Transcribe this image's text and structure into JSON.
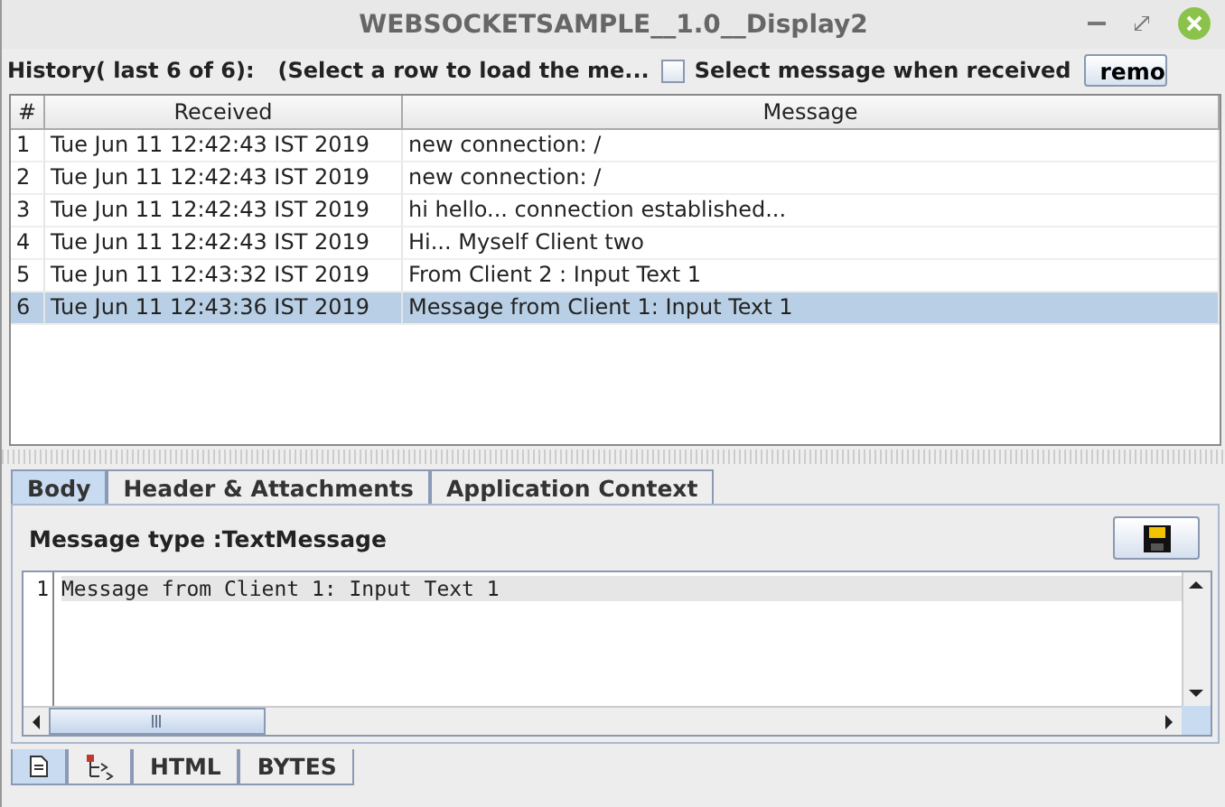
{
  "window": {
    "title": "WEBSOCKETSAMPLE__1.0__Display2"
  },
  "toolbar": {
    "history_label": "History( last 6 of 6):",
    "hint": "(Select a row to load the me...",
    "auto_select": {
      "label": "Select message when received",
      "checked": false
    },
    "remove_button": "remo"
  },
  "table": {
    "columns": [
      "#",
      "Received",
      "Message"
    ],
    "rows": [
      {
        "cells": [
          "1",
          "Tue Jun 11 12:42:43 IST 2019",
          "new connection: /"
        ],
        "selected": false
      },
      {
        "cells": [
          "2",
          "Tue Jun 11 12:42:43 IST 2019",
          "new connection: /"
        ],
        "selected": false
      },
      {
        "cells": [
          "3",
          "Tue Jun 11 12:42:43 IST 2019",
          "hi hello... connection established..."
        ],
        "selected": false
      },
      {
        "cells": [
          "4",
          "Tue Jun 11 12:42:43 IST 2019",
          "Hi... Myself Client two"
        ],
        "selected": false
      },
      {
        "cells": [
          "5",
          "Tue Jun 11 12:43:32 IST 2019",
          "From Client 2 : Input Text 1"
        ],
        "selected": false
      },
      {
        "cells": [
          "6",
          "Tue Jun 11 12:43:36 IST 2019",
          "Message from Client 1: Input Text 1"
        ],
        "selected": true
      }
    ]
  },
  "tabs": [
    {
      "label": "Body",
      "selected": true
    },
    {
      "label": "Header & Attachments",
      "selected": false
    },
    {
      "label": "Application Context",
      "selected": false
    }
  ],
  "body": {
    "message_type": "Message type :TextMessage",
    "editor_lines": [
      {
        "number": "1",
        "text": "Message from Client 1: Input Text 1"
      }
    ]
  },
  "view_tabs": [
    {
      "kind": "document",
      "selected": true
    },
    {
      "kind": "tree",
      "selected": false
    },
    {
      "kind": "text",
      "label": "HTML",
      "selected": false
    },
    {
      "kind": "text",
      "label": "BYTES",
      "selected": false
    }
  ]
}
